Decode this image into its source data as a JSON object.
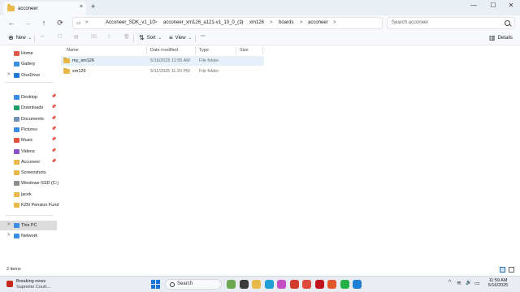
{
  "tab": {
    "title": "acconeer",
    "close": "×",
    "new_tab": "+"
  },
  "window_controls": {
    "minimize": "—",
    "maximize": "☐",
    "close": "✕"
  },
  "nav": {
    "back": "←",
    "forward": "→",
    "up": "↑",
    "refresh": "⟳"
  },
  "address": {
    "crumbs": [
      "Acconeer_SDK_v1_10",
      "acconeer_xm126_a121-v1_10_0_(1)",
      "xm126",
      "boards",
      "acconeer"
    ],
    "separator": ">"
  },
  "search": {
    "placeholder": "Search acconeer"
  },
  "commands": {
    "new": "New",
    "sort": "Sort",
    "view": "View",
    "more": "···",
    "details": "Details"
  },
  "sidebar": {
    "top": [
      {
        "label": "Home",
        "icon": "home-icon",
        "color": "#e05a47"
      },
      {
        "label": "Gallery",
        "icon": "gallery-icon",
        "color": "#3a8ee6"
      },
      {
        "label": "OneDrive",
        "icon": "cloud-icon",
        "color": "#1f78d1",
        "expand": ">"
      }
    ],
    "quick": [
      {
        "label": "Desktop",
        "icon": "desktop-icon",
        "color": "#3a8ee6",
        "pin": "📌"
      },
      {
        "label": "Downloads",
        "icon": "downloads-icon",
        "color": "#1f9e6a",
        "pin": "📌"
      },
      {
        "label": "Documents",
        "icon": "documents-icon",
        "color": "#6f8fb5",
        "pin": "📌"
      },
      {
        "label": "Pictures",
        "icon": "pictures-icon",
        "color": "#3a8ee6",
        "pin": "📌"
      },
      {
        "label": "Music",
        "icon": "music-icon",
        "color": "#e0533a",
        "pin": "📌"
      },
      {
        "label": "Videos",
        "icon": "videos-icon",
        "color": "#8a52c4",
        "pin": "📌"
      },
      {
        "label": "Acconeer",
        "icon": "folder-icon",
        "color": "#e8b84a",
        "pin": "📌"
      },
      {
        "label": "Screenshots",
        "icon": "folder-icon",
        "color": "#e8b84a"
      },
      {
        "label": "Windows-SSD (C:)",
        "icon": "drive-icon",
        "color": "#8c8c8c"
      },
      {
        "label": "jacek",
        "icon": "folder-icon",
        "color": "#e8b84a"
      },
      {
        "label": "KZN Pension Fund",
        "icon": "folder-icon",
        "color": "#e8b84a"
      }
    ],
    "bottom": [
      {
        "label": "This PC",
        "icon": "pc-icon",
        "color": "#3a8ee6",
        "expand": ">",
        "selected": true
      },
      {
        "label": "Network",
        "icon": "network-icon",
        "color": "#3a8ee6",
        "expand": ">"
      }
    ]
  },
  "columns": {
    "name": "Name",
    "date": "Date modified",
    "type": "Type",
    "size": "Size"
  },
  "files": [
    {
      "name": "my_xm126",
      "date": "5/16/2025 11:55 AM",
      "type": "File folder",
      "size": "",
      "selected": true
    },
    {
      "name": "xm126",
      "date": "5/11/2025 11:20 PM",
      "type": "File folder",
      "size": ""
    }
  ],
  "status": {
    "count": "2 items"
  },
  "taskbar": {
    "news_title": "Breaking news",
    "news_sub": "Supreme Court...",
    "search_label": "Search",
    "apps": [
      {
        "name": "nature-widget",
        "color": "#6aa84f"
      },
      {
        "name": "task-view",
        "color": "#3b3b3b"
      },
      {
        "name": "file-explorer",
        "color": "#e8b84a"
      },
      {
        "name": "edge",
        "color": "#1f9ed8"
      },
      {
        "name": "copilot",
        "color": "#c44fc4"
      },
      {
        "name": "app-red",
        "color": "#d23a2f"
      },
      {
        "name": "chrome",
        "color": "#e04a3a"
      },
      {
        "name": "mcafee",
        "color": "#c0151f"
      },
      {
        "name": "office",
        "color": "#e3582b"
      },
      {
        "name": "whatsapp",
        "color": "#25b04a"
      },
      {
        "name": "vscode",
        "color": "#1f7fd1"
      }
    ],
    "tray": {
      "chevron": "^",
      "wifi": "≋",
      "volume": "🔊",
      "battery": "▭"
    },
    "time": "11:59 AM",
    "date": "5/16/2025"
  }
}
